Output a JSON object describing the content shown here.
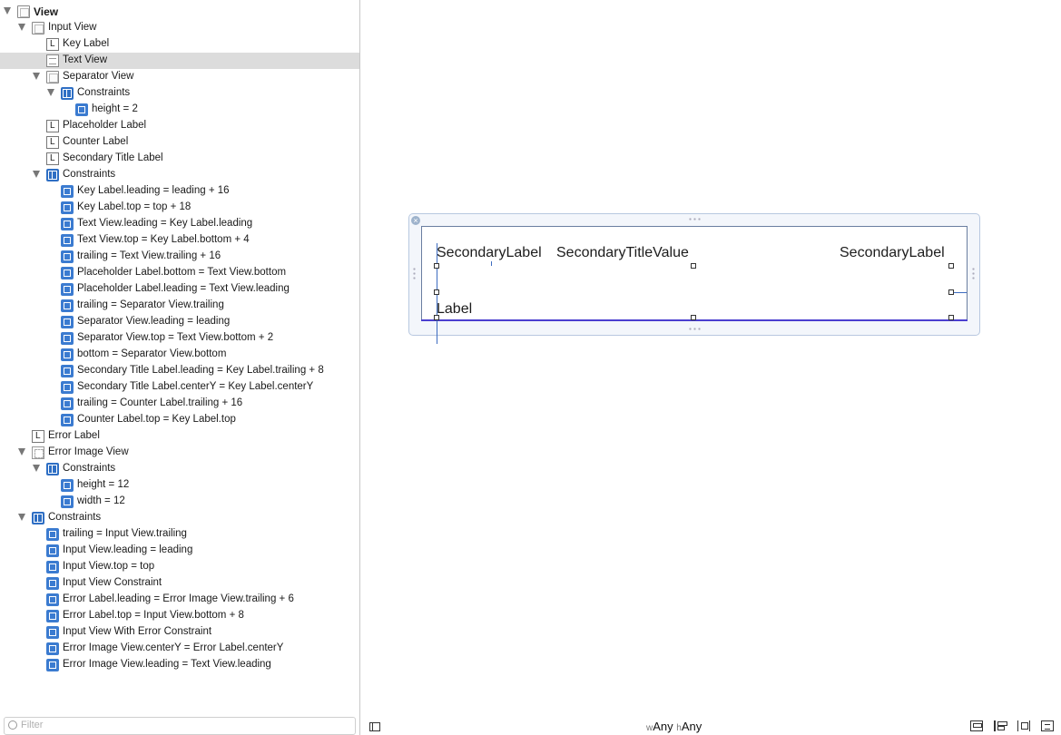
{
  "outline": {
    "rows": [
      {
        "label": "View",
        "icon": "view",
        "tri": true,
        "top": true
      },
      {
        "label": "Input View",
        "icon": "view",
        "tri": true
      },
      {
        "label": "Key Label",
        "icon": "label"
      },
      {
        "label": "Text View",
        "icon": "textview",
        "selected": true
      },
      {
        "label": "Separator View",
        "icon": "view",
        "tri": true
      },
      {
        "label": "Constraints",
        "icon": "constraints",
        "tri": true
      },
      {
        "label": "height = 2",
        "icon": "constraint"
      },
      {
        "label": "Placeholder Label",
        "icon": "label"
      },
      {
        "label": "Counter Label",
        "icon": "label"
      },
      {
        "label": "Secondary Title Label",
        "icon": "label"
      },
      {
        "label": "Constraints",
        "icon": "constraints",
        "tri": true
      },
      {
        "label": "Key Label.leading = leading + 16",
        "icon": "constraint"
      },
      {
        "label": "Key Label.top = top + 18",
        "icon": "constraint"
      },
      {
        "label": "Text View.leading = Key Label.leading",
        "icon": "constraint"
      },
      {
        "label": "Text View.top = Key Label.bottom + 4",
        "icon": "constraint"
      },
      {
        "label": "trailing = Text View.trailing + 16",
        "icon": "constraint"
      },
      {
        "label": "Placeholder Label.bottom = Text View.bottom",
        "icon": "constraint"
      },
      {
        "label": "Placeholder Label.leading = Text View.leading",
        "icon": "constraint"
      },
      {
        "label": "trailing = Separator View.trailing",
        "icon": "constraint"
      },
      {
        "label": "Separator View.leading = leading",
        "icon": "constraint"
      },
      {
        "label": "Separator View.top = Text View.bottom + 2",
        "icon": "constraint"
      },
      {
        "label": "bottom = Separator View.bottom",
        "icon": "constraint"
      },
      {
        "label": "Secondary Title Label.leading = Key Label.trailing + 8",
        "icon": "constraint"
      },
      {
        "label": "Secondary Title Label.centerY = Key Label.centerY",
        "icon": "constraint"
      },
      {
        "label": "trailing = Counter Label.trailing + 16",
        "icon": "constraint"
      },
      {
        "label": "Counter Label.top = Key Label.top",
        "icon": "constraint"
      },
      {
        "label": "Error Label",
        "icon": "label"
      },
      {
        "label": "Error Image View",
        "icon": "image",
        "tri": true
      },
      {
        "label": "Constraints",
        "icon": "constraints",
        "tri": true
      },
      {
        "label": "height = 12",
        "icon": "constraint"
      },
      {
        "label": "width = 12",
        "icon": "constraint"
      },
      {
        "label": "Constraints",
        "icon": "constraints",
        "tri": true
      },
      {
        "label": "trailing = Input View.trailing",
        "icon": "constraint"
      },
      {
        "label": "Input View.leading = leading",
        "icon": "constraint"
      },
      {
        "label": "Input View.top = top",
        "icon": "constraint"
      },
      {
        "label": "Input View Constraint",
        "icon": "constraint"
      },
      {
        "label": "Error Label.leading = Error Image View.trailing + 6",
        "icon": "constraint"
      },
      {
        "label": "Error Label.top = Input View.bottom + 8",
        "icon": "constraint"
      },
      {
        "label": "Input View With Error Constraint",
        "icon": "constraint"
      },
      {
        "label": "Error Image View.centerY = Error Label.centerY",
        "icon": "constraint"
      },
      {
        "label": "Error Image View.leading = Text View.leading",
        "icon": "constraint"
      }
    ],
    "filter_placeholder": "Filter"
  },
  "canvas": {
    "key_label": "SecondaryLabel",
    "secondary_title": "SecondaryTitleValue",
    "counter_label": "SecondaryLabel",
    "placeholder_label": "Label"
  },
  "bottom_bar": {
    "w_prefix": "w",
    "w_value": "Any",
    "h_prefix": "h",
    "h_value": "Any"
  },
  "colors": {
    "selection": "#dcdcdc",
    "constraint_icon": "#3b7bd0",
    "separator_line": "#4a3fd0"
  }
}
